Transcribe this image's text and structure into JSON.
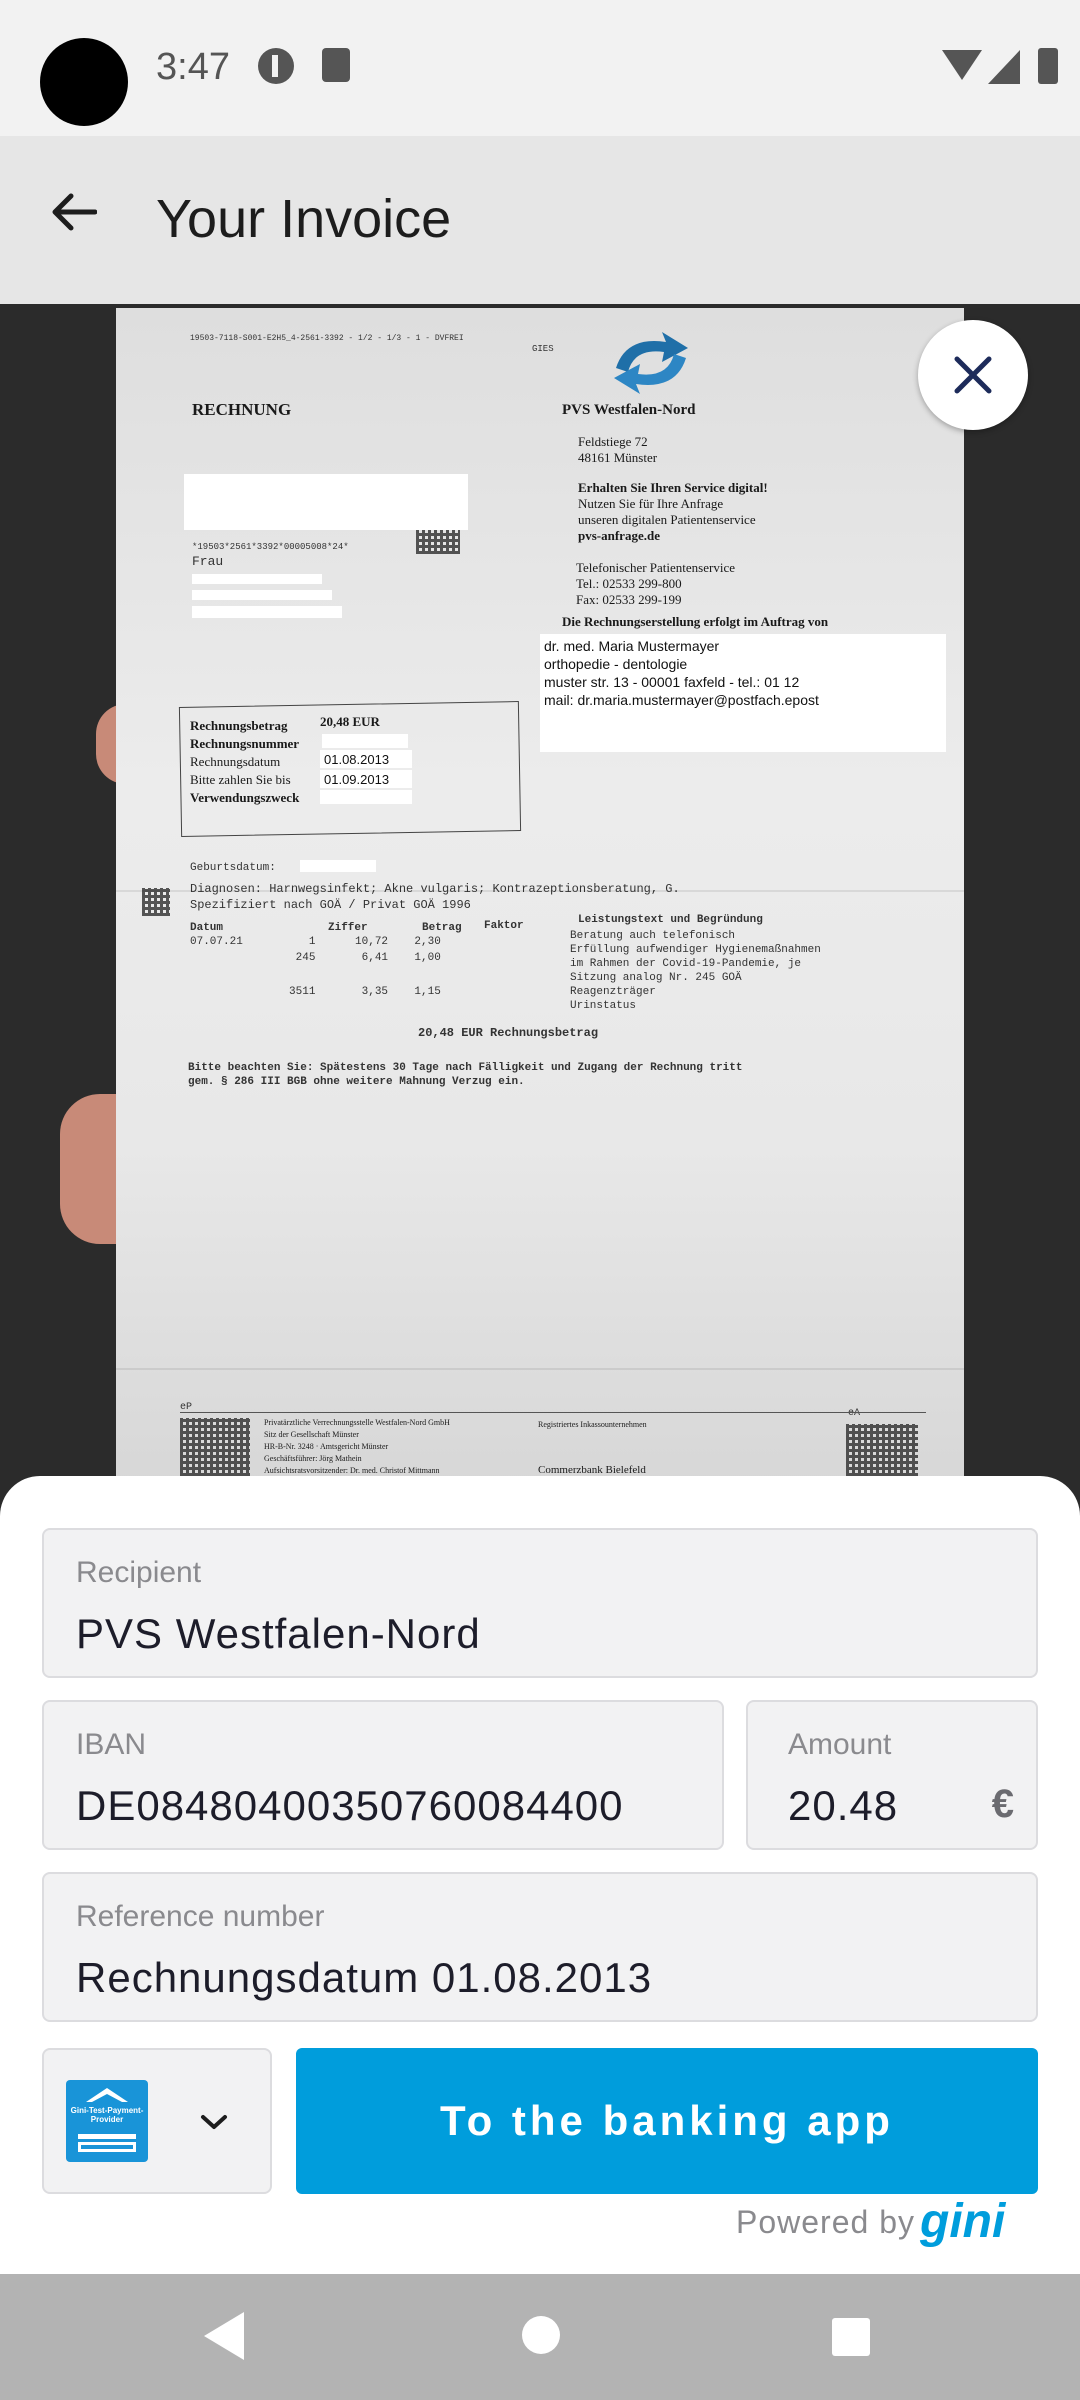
{
  "status_bar": {
    "time": "3:47"
  },
  "app_bar": {
    "title": "Your Invoice"
  },
  "document": {
    "header_code": "19503-7118-S001-E2H5_4-2561-3392 - 1/2 - 1/3 - 1 - DVFREI",
    "gies": "GIES",
    "title": "RECHNUNG",
    "company": "PVS Westfalen-Nord",
    "street": "Feldstiege 72",
    "city": "48161 Münster",
    "service_line1": "Erhalten Sie Ihren Service digital!",
    "service_line2": "Nutzen Sie für Ihre Anfrage",
    "service_line3": "unseren digitalen Patientenservice",
    "service_url": "pvs-anfrage.de",
    "phone_title": "Telefonischer Patientenservice",
    "tel": "Tel.: 02533 299-800",
    "fax": "Fax: 02533 299-199",
    "auftrag": "Die Rechnungserstellung erfolgt im Auftrag von",
    "barcode_text": "*19503*2561*3392*00005008*24*",
    "frau": "Frau",
    "doctor_name": "dr. med. Maria Mustermayer",
    "doctor_field": "orthopedie - dentologie",
    "doctor_address": "muster str. 13 - 00001 faxfeld - tel.: 01 12",
    "doctor_mail": "mail: dr.maria.mustermayer@postfach.epost",
    "box_betrag_label": "Rechnungsbetrag",
    "box_betrag_value": "20,48 EUR",
    "box_nummer_label": "Rechnungsnummer",
    "box_datum_label": "Rechnungsdatum",
    "box_datum_value": "01.08.2013",
    "box_bis_label": "Bitte zahlen Sie bis",
    "box_bis_value": "01.09.2013",
    "box_zweck_label": "Verwendungszweck",
    "geburtsdatum": "Geburtsdatum:",
    "diagnosen": "Diagnosen: Harnwegsinfekt; Akne vulgaris; Kontrazeptionsberatung, G.",
    "spezifiziert": "Spezifiziert nach GOÄ / Privat GOÄ 1996",
    "col_datum": "Datum",
    "col_ziffer": "Ziffer",
    "col_betrag": "Betrag",
    "col_faktor": "Faktor",
    "col_leistung": "Leistungstext und Begründung",
    "row1": "07.07.21          1      10,72    2,30",
    "row2": "                245       6,41    1,00",
    "row3": "               3511       3,35    1,15",
    "leistung1": "Beratung auch telefonisch",
    "leistung2": "Erfüllung aufwendiger Hygienemaßnahmen",
    "leistung3": "im Rahmen der Covid-19-Pandemie, je",
    "leistung4": "Sitzung analog Nr. 245 GOÄ",
    "leistung5": "Reagenzträger",
    "leistung6": "Urinstatus",
    "total": "20,48 EUR Rechnungsbetrag",
    "notice1": "Bitte beachten Sie: Spätestens 30 Tage nach Fälligkeit und Zugang der Rechnung tritt",
    "notice2": "gem. § 286 III BGB ohne weitere Mahnung Verzug ein.",
    "footer_ep": "eP",
    "footer_ea": "eA",
    "footer1": "Privatärztliche Verrechnungsstelle Westfalen-Nord GmbH",
    "footer2": "Sitz der Gesellschaft Münster",
    "footer3": "HR-B-Nr. 3248 · Amtsgericht Münster",
    "footer4": "Geschäftsführer: Jörg Mathein",
    "footer5": "Aufsichtsratsvorsitzender: Dr. med. Christof Mittmann",
    "footer_inkasso": "Registriertes Inkassounternehmen",
    "footer_bank": "Commerzbank Bielefeld"
  },
  "form": {
    "recipient": {
      "label": "Recipient",
      "value": "PVS Westfalen-Nord"
    },
    "iban": {
      "label": "IBAN",
      "value": "DE08480400350760084400"
    },
    "amount": {
      "label": "Amount",
      "value": "20.48",
      "currency": "€"
    },
    "reference": {
      "label": "Reference number",
      "value": "Rechnungsdatum 01.08.2013"
    }
  },
  "provider": {
    "name": "Gini-Test-Payment-Provider"
  },
  "actions": {
    "bank_button": "To the banking app"
  },
  "footer": {
    "powered_by": "Powered by",
    "brand": "gini"
  },
  "colors": {
    "accent": "#009ddc",
    "close_icon": "#1d2b5a"
  },
  "icons": {
    "back": "arrow-left-icon",
    "close": "close-icon",
    "chevron": "chevron-down-icon",
    "nav_back": "triangle-back-icon",
    "nav_home": "circle-home-icon",
    "nav_recents": "square-recents-icon"
  }
}
